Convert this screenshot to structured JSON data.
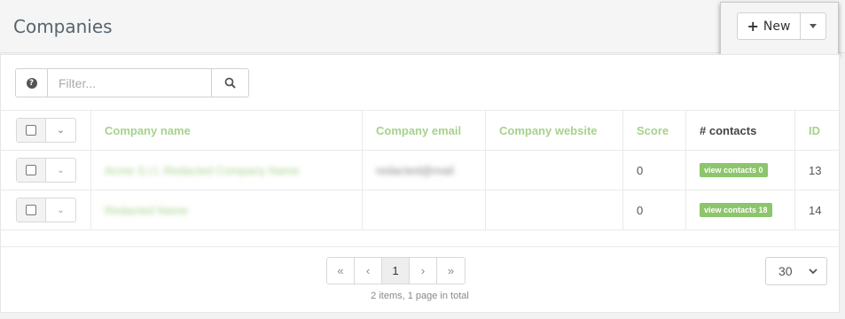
{
  "header": {
    "title": "Companies",
    "new_label": "New",
    "new_icon": "plus-icon"
  },
  "filter": {
    "placeholder": "Filter...",
    "help_glyph": "?",
    "search_icon": "search-icon"
  },
  "table": {
    "columns": [
      "Company name",
      "Company email",
      "Company website",
      "Score",
      "# contacts",
      "ID"
    ],
    "rows": [
      {
        "name": "Acme S.r.l. Redacted Company Name",
        "email": "redacted@mail",
        "website": "",
        "score": "0",
        "contacts": "view contacts 0",
        "id": "13"
      },
      {
        "name": "Redacted Name",
        "email": "",
        "website": "",
        "score": "0",
        "contacts": "view contacts 18",
        "id": "14"
      }
    ]
  },
  "pagination": {
    "first": "«",
    "prev": "‹",
    "current": "1",
    "next": "›",
    "last": "»",
    "info": "2 items, 1 page in total",
    "per_page": "30"
  },
  "colors": {
    "accent": "#a6d28c",
    "badge": "#8cc56b"
  }
}
